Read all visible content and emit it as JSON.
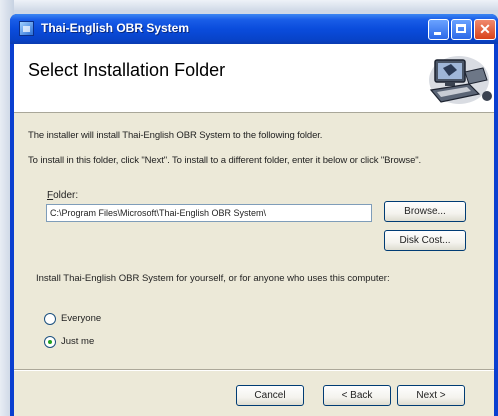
{
  "window": {
    "title": "Thai-English OBR System"
  },
  "header": {
    "title": "Select Installation Folder",
    "graphic_icon": "computer-install-icon"
  },
  "body": {
    "instruction_1": "The installer will install Thai-English OBR System to the following folder.",
    "instruction_2": "To install in this folder, click \"Next\". To install to a different folder, enter it below or click \"Browse\".",
    "folder_label_accel": "F",
    "folder_label_rest": "older:",
    "folder_value": "C:\\Program Files\\Microsoft\\Thai-English OBR System\\",
    "browse_label": "Browse...",
    "disk_cost_label": "Disk Cost...",
    "install_for_text": "Install Thai-English OBR System for yourself, or for anyone who uses this computer:",
    "options": [
      {
        "label": "Everyone",
        "selected": false
      },
      {
        "label": "Just me",
        "selected": true
      }
    ]
  },
  "footer": {
    "cancel_label": "Cancel",
    "back_label": "< Back",
    "next_label": "Next >"
  },
  "colors": {
    "titlebar": "#0a4cdc",
    "dialog_background": "#ece9d8",
    "close_button": "#d8421a"
  }
}
